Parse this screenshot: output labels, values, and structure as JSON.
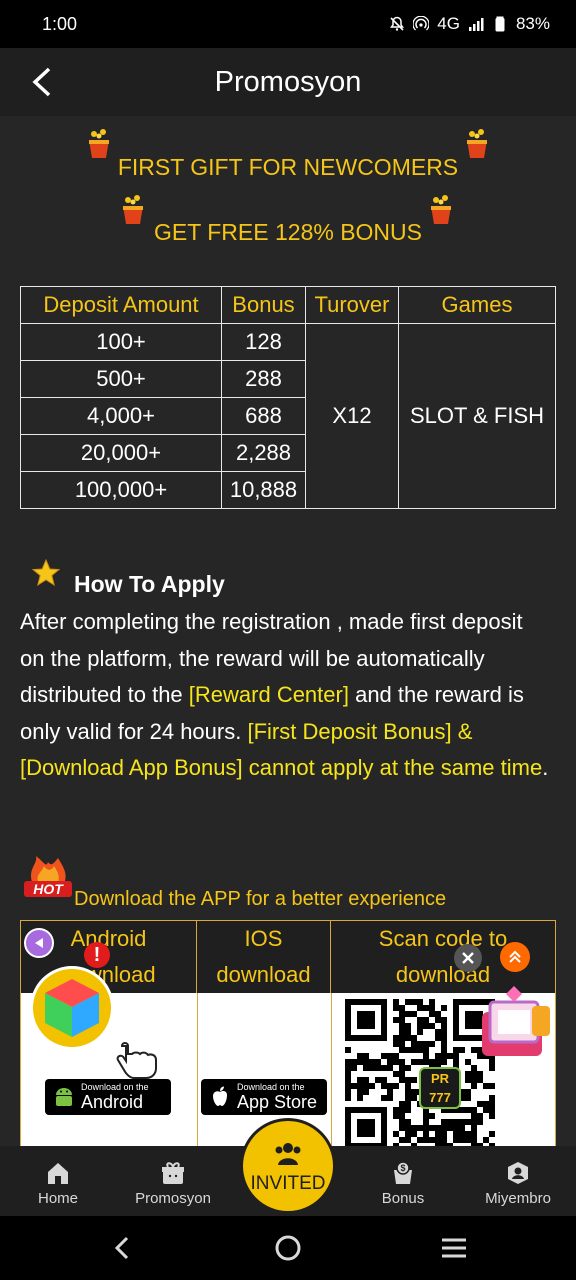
{
  "status": {
    "time": "1:00",
    "network": "4G",
    "battery": "83%"
  },
  "header": {
    "title": "Promosyon"
  },
  "promo": {
    "line1": "FIRST GIFT FOR NEWCOMERS",
    "line2": "GET FREE 128% BONUS"
  },
  "table": {
    "headers": [
      "Deposit Amount",
      "Bonus",
      "Turover",
      "Games"
    ],
    "rows": [
      {
        "deposit": "100+",
        "bonus": "128"
      },
      {
        "deposit": "500+",
        "bonus": "288"
      },
      {
        "deposit": "4,000+",
        "bonus": "688"
      },
      {
        "deposit": "20,000+",
        "bonus": "2,288"
      },
      {
        "deposit": "100,000+",
        "bonus": "10,888"
      }
    ],
    "turnover": "X12",
    "games": "SLOT & FISH"
  },
  "apply": {
    "heading": "How To Apply",
    "text1": "After completing the registration , made first deposit on the platform, the reward will be automatically distributed to the ",
    "highlight1": "[Reward Center]",
    "text2": " and the reward is only valid for 24 hours. ",
    "highlight2": "[First Deposit Bonus] & [Download App Bonus] cannot apply at the same time",
    "text3": "."
  },
  "download": {
    "badge": "HOT",
    "heading": "Download the APP for a better experience",
    "col1": "Android download",
    "col2": "IOS download",
    "col3": "Scan code to download",
    "android_small": "Download on the",
    "android_big": "Android",
    "ios_small": "Download on the",
    "ios_big": "App Store",
    "qr_logo": "PR 777"
  },
  "tabs": {
    "home": "Home",
    "promo": "Promosyon",
    "invited": "INVITED",
    "bonus": "Bonus",
    "member": "Miyembro"
  },
  "colors": {
    "accent": "#f5c518",
    "highlight": "#f5e51a",
    "background": "#262626",
    "bar": "#1f1f1f"
  }
}
